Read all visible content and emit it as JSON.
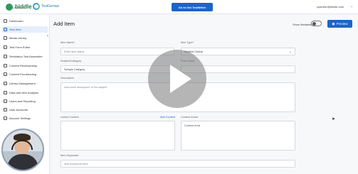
{
  "topbar": {
    "logo_text": "biddle",
    "logo_sub": "consulting group",
    "brand2": "TestGenius",
    "cta_button": "Go to Old TestWriter",
    "user_email": "cpsmiler@biddle.com"
  },
  "sidebar": {
    "items": [
      {
        "label": "Dashboard",
        "active": false
      },
      {
        "label": "New Item",
        "active": true
      },
      {
        "label": "Media Library",
        "active": false
      },
      {
        "label": "Test Form Editor",
        "active": false
      },
      {
        "label": "Simulation Test Assembler",
        "active": false
      },
      {
        "label": "Content Reviewership",
        "active": false
      },
      {
        "label": "Content Proofreading",
        "active": false
      },
      {
        "label": "Library Management",
        "active": false
      },
      {
        "label": "Data and Item Analysis",
        "active": false
      },
      {
        "label": "Users and Reporting",
        "active": false
      },
      {
        "label": "User Accounts",
        "active": false
      },
      {
        "label": "Account Settings",
        "active": false
      }
    ]
  },
  "main": {
    "title": "Add Item",
    "toggle_label": "Show Metadata",
    "preview_label": "Preview",
    "fields": {
      "item_name_label": "Item Name*",
      "item_name_placeholder": "Enter item Name",
      "item_type_label": "Item Type*",
      "item_type_value": "Multiple Choice",
      "subject_label": "Subject/Category",
      "subject_placeholder": "Sample Category",
      "points_label": "Point Value",
      "description_label": "Description",
      "description_placeholder": "Add some description of the subject",
      "related_items_label": "Linked Content",
      "add_content_link": "Add Content",
      "content_area_label": "Content Areas",
      "content_area_placeholder": "Content Area",
      "keywords_label": "Item Keywords",
      "keywords_placeholder": "Add Keywords Here"
    }
  },
  "icons": {
    "play": "play-icon",
    "eye": "eye-icon",
    "collapse": "chevron-left-icon"
  },
  "colors": {
    "accent": "#1b64c9",
    "brand_green": "#2a9d5a"
  }
}
